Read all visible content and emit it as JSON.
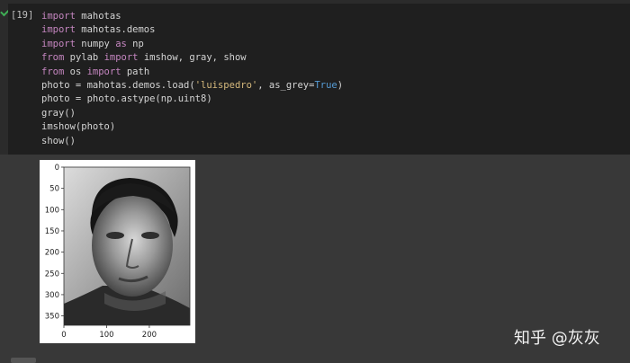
{
  "cell": {
    "prompt": "[19]",
    "status_icon": "check-icon",
    "code_lines": [
      [
        {
          "t": "import",
          "c": "kw"
        },
        {
          "t": " mahotas"
        }
      ],
      [
        {
          "t": "import",
          "c": "kw"
        },
        {
          "t": " mahotas.demos"
        }
      ],
      [
        {
          "t": "import",
          "c": "kw"
        },
        {
          "t": " numpy "
        },
        {
          "t": "as",
          "c": "kw"
        },
        {
          "t": " np"
        }
      ],
      [
        {
          "t": "from",
          "c": "kw"
        },
        {
          "t": " pylab "
        },
        {
          "t": "import",
          "c": "kw"
        },
        {
          "t": " imshow, gray, show"
        }
      ],
      [
        {
          "t": "from",
          "c": "kw"
        },
        {
          "t": " os "
        },
        {
          "t": "import",
          "c": "kw"
        },
        {
          "t": " path"
        }
      ],
      [
        {
          "t": "photo = mahotas.demos.load("
        },
        {
          "t": "'luispedro'",
          "c": "str"
        },
        {
          "t": ", as_grey="
        },
        {
          "t": "True",
          "c": "bool"
        },
        {
          "t": ")"
        }
      ],
      [
        {
          "t": "photo = photo.astype(np.uint8)"
        }
      ],
      [
        {
          "t": "gray()"
        }
      ],
      [
        {
          "t": "imshow(photo)"
        }
      ],
      [
        {
          "t": "show()"
        }
      ]
    ]
  },
  "output": {
    "y_ticks": [
      "0",
      "50",
      "100",
      "150",
      "200",
      "250",
      "300",
      "350"
    ],
    "x_ticks": [
      "0",
      "100",
      "200"
    ],
    "image_alt": "grayscale portrait photo"
  },
  "watermark": "知乎 @灰灰"
}
